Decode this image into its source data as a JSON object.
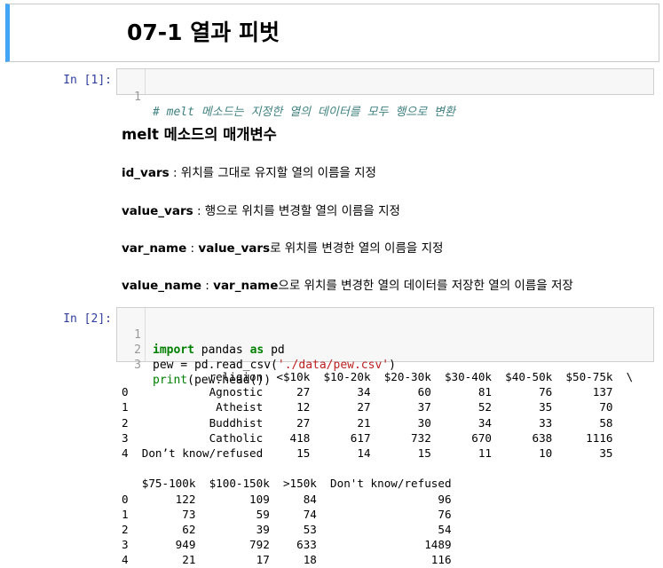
{
  "title": "07-1 열과 피벗",
  "cell1": {
    "prompt": "In [1]:",
    "lines": [
      {
        "num": "1",
        "comment": "# melt 메소드는 지정한 열의 데이터를 모두 행으로 변환"
      }
    ]
  },
  "section_heading": "melt 메소드의 매개변수",
  "params": [
    {
      "name": "id_vars",
      "desc": " : 위치를 그대로 유지할 열의 이름을 지정"
    },
    {
      "name": "value_vars",
      "desc": " : 행으로 위치를 변경할 열의 이름을 지정"
    },
    {
      "name": "var_name",
      "sep": " : ",
      "ref": "value_vars",
      "desc": "로 위치를 변경한 열의 이름을 지정"
    },
    {
      "name": "value_name",
      "sep": " : ",
      "ref": "var_name",
      "desc": "으로 위치를 변경한 열의 데이터를 저장한 열의 이름을 저장"
    }
  ],
  "cell2": {
    "prompt": "In [2]:",
    "line_numbers": [
      "1",
      "2",
      "3"
    ],
    "line1": {
      "kw1": "import",
      "mid": " pandas ",
      "kw2": "as",
      "end": " pd"
    },
    "line2": {
      "pre": "pew = pd.read_csv(",
      "str": "'./data/pew.csv'",
      "post": ")"
    },
    "line3": {
      "bi": "print",
      "rest": "(pew.head())"
    }
  },
  "output_text": "             religion  <$10k  $10-20k  $20-30k  $30-40k  $40-50k  $50-75k  \\\n0            Agnostic     27       34       60       81       76      137\n1             Atheist     12       27       37       52       35       70\n2            Buddhist     27       21       30       34       33       58\n3            Catholic    418      617      732      670      638     1116\n4  Don’t know/refused     15       14       15       11       10       35\n\n   $75-100k  $100-150k  >150k  Don't know/refused\n0       122        109     84                  96\n1        73         59     74                  76\n2        62         39     53                  54\n3       949        792    633                1489\n4        21         17     18                 116"
}
